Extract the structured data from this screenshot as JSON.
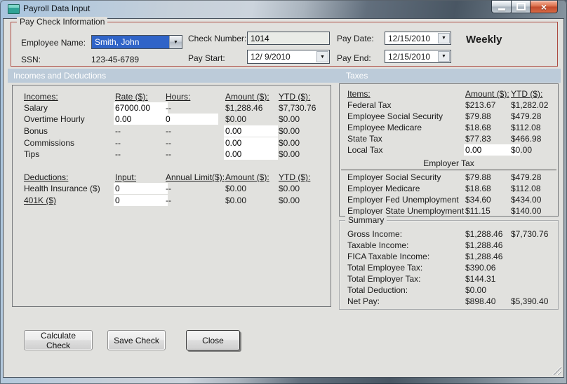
{
  "colors": {
    "client_bg": "#e1e1de",
    "section_header_bg": "#bccbd9",
    "groupbox_border_red": "#ac4a41",
    "selection_blue": "#3064c8",
    "close_button_red": "#c24c2e",
    "titlebar_dark": "#495663",
    "titlebar_light": "#c6d0da"
  },
  "icons": {
    "chevron_down": "▼",
    "close_glyph": "×"
  },
  "window": {
    "title": "Payroll Data Input"
  },
  "paycheck": {
    "group_label": "Pay Check Information",
    "employee_name_label": "Employee Name:",
    "employee_name_value": "Smith, John",
    "ssn_label": "SSN:",
    "ssn_value": "123-45-6789",
    "check_number_label": "Check Number:",
    "check_number_value": "1014",
    "pay_start_label": "Pay Start:",
    "pay_start_value": "12/ 9/2010",
    "pay_date_label": "Pay Date:",
    "pay_date_value": "12/15/2010",
    "pay_end_label": "Pay End:",
    "pay_end_value": "12/15/2010",
    "frequency_label": "Weekly"
  },
  "section_headers": {
    "left": "Incomes and Deductions",
    "right": "Taxes"
  },
  "incomes": {
    "col_label": "Incomes:",
    "col_rate": "Rate ($):",
    "col_hours": "Hours:",
    "col_amount": "Amount ($):",
    "col_ytd": "YTD ($):",
    "salary": {
      "label": "Salary",
      "rate": "67000.00",
      "hours": "--",
      "amount": "$1,288.46",
      "ytd": "$7,730.76"
    },
    "overtime": {
      "label": "Overtime Hourly",
      "rate": "0.00",
      "hours": "0",
      "amount": "$0.00",
      "ytd": "$0.00"
    },
    "bonus": {
      "label": "Bonus",
      "rate": "--",
      "hours": "--",
      "amount": "0.00",
      "ytd": "$0.00"
    },
    "commissions": {
      "label": "Commissions",
      "rate": "--",
      "hours": "--",
      "amount": "0.00",
      "ytd": "$0.00"
    },
    "tips": {
      "label": "Tips",
      "rate": "--",
      "hours": "--",
      "amount": "0.00",
      "ytd": "$0.00"
    }
  },
  "deductions": {
    "col_label": "Deductions:",
    "col_input": "Input:",
    "col_limit": "Annual Limit($):",
    "col_amount": "Amount ($):",
    "col_ytd": "YTD ($):",
    "health": {
      "label": "Health Insurance  ($)",
      "input": "0",
      "limit": "--",
      "amount": "$0.00",
      "ytd": "$0.00"
    },
    "k401": {
      "label": "401K  ($)",
      "input": "0",
      "limit": "--",
      "amount": "$0.00",
      "ytd": "$0.00"
    }
  },
  "taxes": {
    "col_items": "Items:",
    "col_amount": "Amount ($):",
    "col_ytd": "YTD ($):",
    "rows": [
      {
        "label": "Federal Tax",
        "amount": "$213.67",
        "ytd": "$1,282.02"
      },
      {
        "label": "Employee Social Security",
        "amount": "$79.88",
        "ytd": "$479.28"
      },
      {
        "label": "Employee Medicare",
        "amount": "$18.68",
        "ytd": "$112.08"
      },
      {
        "label": "State Tax",
        "amount": "$77.83",
        "ytd": "$466.98"
      }
    ],
    "local": {
      "label": "Local Tax",
      "amount": "0.00",
      "ytd": "$0.00"
    },
    "employer_divider": "Employer Tax",
    "employer_rows": [
      {
        "label": "Employer Social Security",
        "amount": "$79.88",
        "ytd": "$479.28"
      },
      {
        "label": "Employer Medicare",
        "amount": "$18.68",
        "ytd": "$112.08"
      },
      {
        "label": "Employer Fed Unemployment",
        "amount": "$34.60",
        "ytd": "$434.00"
      },
      {
        "label": "Employer State Unemployment",
        "amount": "$11.15",
        "ytd": "$140.00"
      }
    ]
  },
  "summary": {
    "group_label": "Summary",
    "rows": [
      {
        "label": "Gross Income:",
        "amount": "$1,288.46",
        "ytd": "$7,730.76"
      },
      {
        "label": "Taxable Income:",
        "amount": "$1,288.46",
        "ytd": ""
      },
      {
        "label": "FICA Taxable Income:",
        "amount": "$1,288.46",
        "ytd": ""
      },
      {
        "label": "Total Employee Tax:",
        "amount": "$390.06",
        "ytd": ""
      },
      {
        "label": "Total Employer Tax:",
        "amount": "$144.31",
        "ytd": ""
      },
      {
        "label": "Total Deduction:",
        "amount": "$0.00",
        "ytd": ""
      },
      {
        "label": "Net Pay:",
        "amount": "$898.40",
        "ytd": "$5,390.40"
      }
    ]
  },
  "buttons": {
    "calculate": "Calculate Check",
    "save": "Save Check",
    "close": "Close"
  }
}
